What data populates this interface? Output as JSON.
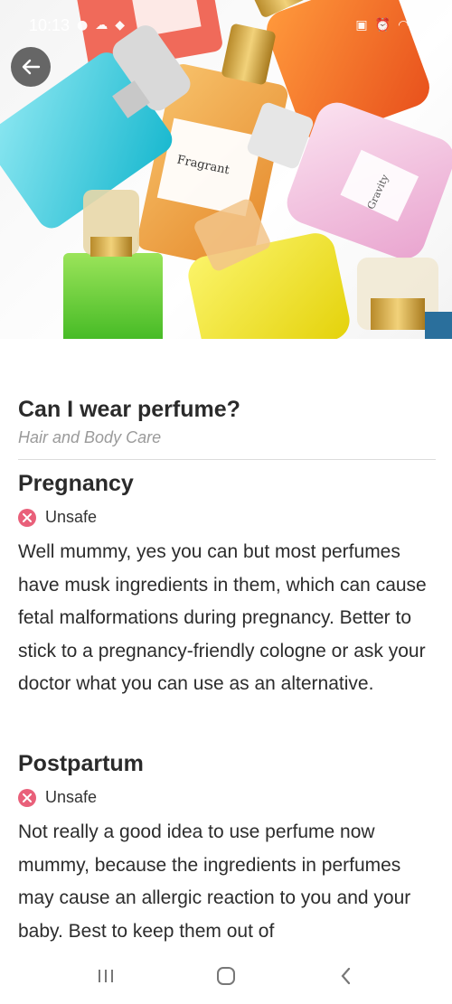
{
  "status_bar": {
    "time": "10:13"
  },
  "hero": {
    "bottle_label_1": "Fragrant",
    "bottle_label_2": "Gravity"
  },
  "article": {
    "title": "Can I wear perfume?",
    "category": "Hair and Body Care",
    "sections": [
      {
        "heading": "Pregnancy",
        "status": "Unsafe",
        "text": "Well mummy, yes you can but most perfumes have musk ingredients in them, which can cause fetal malformations during pregnancy. Better to stick to a pregnancy-friendly cologne or ask your doctor what you can use as an alternative."
      },
      {
        "heading": "Postpartum",
        "status": "Unsafe",
        "text": "Not really a good idea to use perfume now mummy, because the ingredients in perfumes may cause an allergic reaction to you and your baby. Best to keep them out of"
      }
    ]
  },
  "colors": {
    "unsafe": "#e9607a",
    "divider": "#dcdcdc",
    "category": "#9a9a9a"
  },
  "icons": {
    "back": "arrow-left-icon",
    "unsafe": "x-circle-icon",
    "nav_recents": "recents-icon",
    "nav_home": "home-icon",
    "nav_back": "chevron-left-icon"
  }
}
